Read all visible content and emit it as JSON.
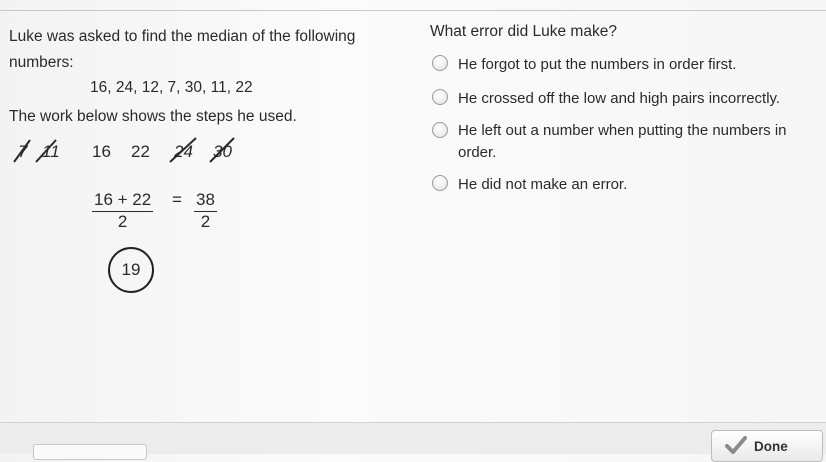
{
  "question": {
    "intro": "Luke was asked to find the median of the following numbers:",
    "numbers": "16, 24, 12, 7, 30, 11, 22",
    "work_intro": "The work below shows the steps he used.",
    "ordered_values": [
      "7",
      "11",
      "16",
      "22",
      "24",
      "30"
    ],
    "fraction_left": {
      "numerator": "16 + 22",
      "denominator": "2"
    },
    "equals": "=",
    "fraction_right": {
      "numerator": "38",
      "denominator": "2"
    },
    "answer": "19"
  },
  "prompt": "What error did Luke make?",
  "options": [
    {
      "label": "He forgot to put the numbers in order first."
    },
    {
      "label": "He crossed off the low and high pairs incorrectly."
    },
    {
      "label": "He left out a number when putting the numbers in order."
    },
    {
      "label": "He did not make an error."
    }
  ],
  "footer": {
    "done_label": "Done"
  },
  "colors": {
    "text": "#2a2a2a",
    "rule": "#c9c9c9",
    "check": "#8a8a8a"
  }
}
